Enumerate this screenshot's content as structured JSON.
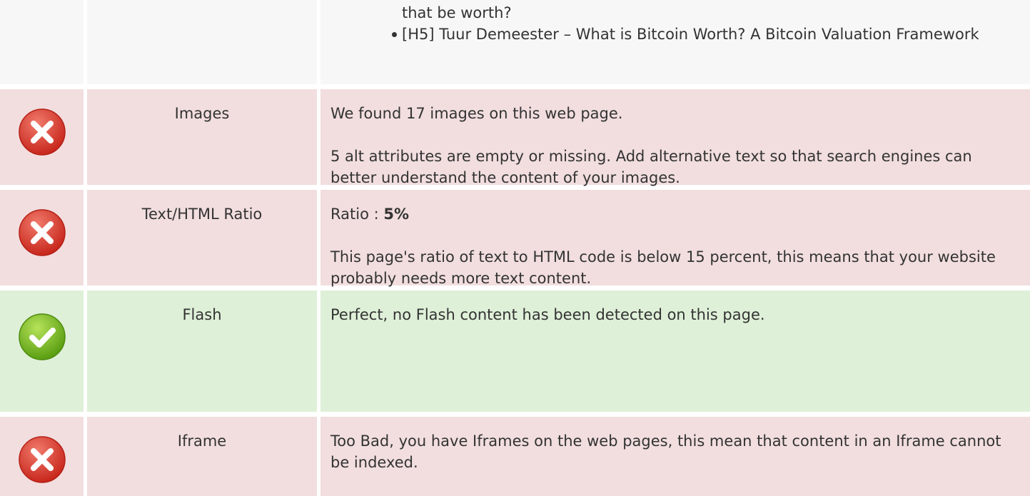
{
  "headings": {
    "continued_text": "that be worth?",
    "items": [
      "[H5] Tuur Demeester – What is Bitcoin Worth? A Bitcoin Valuation Framework"
    ]
  },
  "rows": {
    "images": {
      "status": "error",
      "icon": "error-x-icon",
      "label": "Images",
      "line1": "We found 17 images on this web page.",
      "line2": "5 alt attributes are empty or missing. Add alternative text so that search engines can better understand the content of your images."
    },
    "ratio": {
      "status": "error",
      "icon": "error-x-icon",
      "label": "Text/HTML Ratio",
      "line1_prefix": "Ratio : ",
      "line1_value": "5%",
      "line2": "This page's ratio of text to HTML code is below 15 percent, this means that your website probably needs more text content."
    },
    "flash": {
      "status": "success",
      "icon": "check-icon",
      "label": "Flash",
      "line1": "Perfect, no Flash content has been detected on this page."
    },
    "iframe": {
      "status": "error",
      "icon": "error-x-icon",
      "label": "Iframe",
      "line1": "Too Bad, you have Iframes on the web pages, this mean that content in an Iframe cannot be indexed."
    }
  },
  "colors": {
    "error_bg": "#f2dedf",
    "success_bg": "#dff0d8",
    "neutral_bg": "#f7f7f7",
    "error_icon": "#d9362b",
    "success_icon": "#6cb31a"
  }
}
